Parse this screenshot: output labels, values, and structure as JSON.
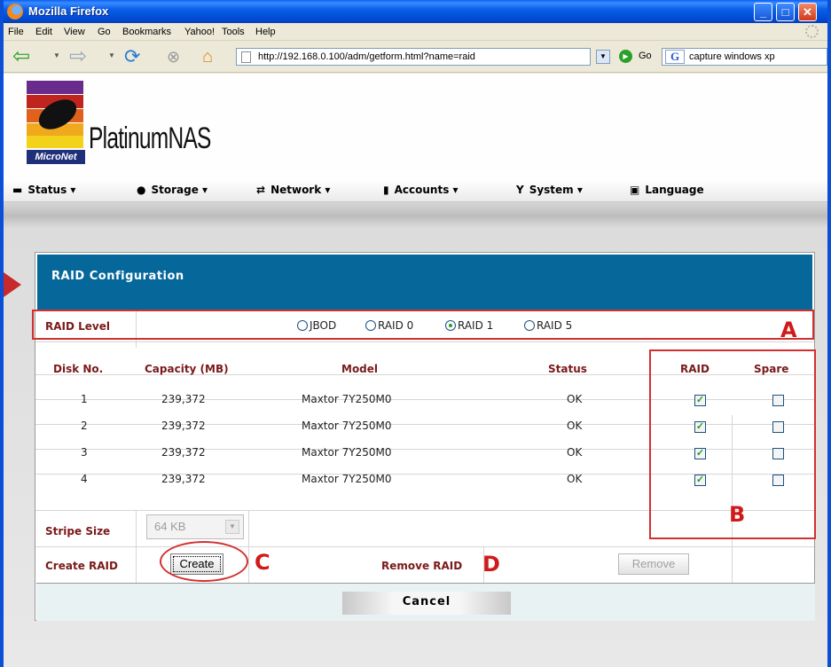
{
  "window": {
    "title": "Mozilla Firefox",
    "controls": [
      "_",
      "□",
      "✕"
    ]
  },
  "menubar": {
    "items": [
      "File",
      "Edit",
      "View",
      "Go",
      "Bookmarks",
      "Yahoo!",
      "Tools",
      "Help"
    ]
  },
  "toolbar": {
    "url": "http://192.168.0.100/adm/getform.html?name=raid",
    "go_label": "Go",
    "search_value": "capture windows xp"
  },
  "brand": {
    "company": "MicroNet",
    "product": "PlatinumNAS"
  },
  "appnav": {
    "items": [
      {
        "label": "Status ▾",
        "icon": "car-icon"
      },
      {
        "label": "Storage ▾",
        "icon": "disk-icon"
      },
      {
        "label": "Network ▾",
        "icon": "network-icon"
      },
      {
        "label": "Accounts ▾",
        "icon": "users-icon"
      },
      {
        "label": "System ▾",
        "icon": "tools-icon"
      },
      {
        "label": "Language",
        "icon": "language-icon"
      }
    ]
  },
  "panel": {
    "title": "RAID Configuration",
    "raid_level_label": "RAID Level",
    "raid_options": [
      "JBOD",
      "RAID 0",
      "RAID 1",
      "RAID 5"
    ],
    "raid_selected": "RAID 1",
    "columns": [
      "Disk No.",
      "Capacity (MB)",
      "Model",
      "Status",
      "RAID",
      "Spare"
    ],
    "rows": [
      {
        "disk": "1",
        "capacity": "239,372",
        "model": "Maxtor 7Y250M0",
        "status": "OK",
        "raid": true,
        "spare": false
      },
      {
        "disk": "2",
        "capacity": "239,372",
        "model": "Maxtor 7Y250M0",
        "status": "OK",
        "raid": true,
        "spare": false
      },
      {
        "disk": "3",
        "capacity": "239,372",
        "model": "Maxtor 7Y250M0",
        "status": "OK",
        "raid": true,
        "spare": false
      },
      {
        "disk": "4",
        "capacity": "239,372",
        "model": "Maxtor 7Y250M0",
        "status": "OK",
        "raid": true,
        "spare": false
      }
    ],
    "stripe_size_label": "Stripe Size",
    "stripe_size_value": "64 KB",
    "create_raid_label": "Create RAID",
    "create_button": "Create",
    "remove_raid_label": "Remove RAID",
    "remove_button": "Remove",
    "cancel_button": "Cancel"
  },
  "annotations": {
    "a": "A",
    "b": "B",
    "c": "C",
    "d": "D"
  },
  "colors": {
    "header_blue": "#06689a",
    "label_red": "#7a1a1a",
    "annotation_red": "#d01a1a"
  }
}
